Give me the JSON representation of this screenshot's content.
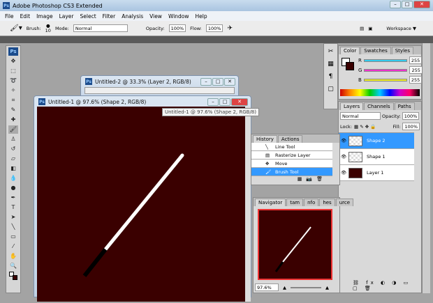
{
  "app": {
    "title": "Adobe Photoshop CS3 Extended",
    "logo": "Ps"
  },
  "menu": [
    "File",
    "Edit",
    "Image",
    "Layer",
    "Select",
    "Filter",
    "Analysis",
    "View",
    "Window",
    "Help"
  ],
  "options": {
    "brush_label": "Brush:",
    "brush_size": "10",
    "mode_label": "Mode:",
    "mode_value": "Normal",
    "opacity_label": "Opacity:",
    "opacity_value": "100%",
    "flow_label": "Flow:",
    "flow_value": "100%",
    "workspace_label": "Workspace ▼"
  },
  "documents": [
    {
      "title": "Untitled-2 @ 33.3% (Layer 2, RGB/8)"
    },
    {
      "title": "Untitled-1 @ 97.6% (Shape 2, RGB/8)",
      "tooltip": "Untitled-1 @ 97.6% (Shape 2, RGB/8)",
      "canvas_color": "#3a0000"
    }
  ],
  "color_panel": {
    "tabs": [
      "Color",
      "Swatches",
      "Styles"
    ],
    "channels": [
      {
        "label": "R",
        "value": "255",
        "color": "#33ccee"
      },
      {
        "label": "G",
        "value": "255",
        "color": "#ee33cc"
      },
      {
        "label": "B",
        "value": "255",
        "color": "#eeee22"
      }
    ],
    "foreground": "#ffffff",
    "background": "#3a0000"
  },
  "layers_panel": {
    "tabs": [
      "Layers",
      "Channels",
      "Paths"
    ],
    "blend_mode": "Normal",
    "opacity_label": "Opacity:",
    "opacity_value": "100%",
    "lock_label": "Lock:",
    "fill_label": "Fill:",
    "fill_value": "100%",
    "layers": [
      {
        "name": "Shape 2",
        "selected": true
      },
      {
        "name": "Shape 1",
        "selected": false
      },
      {
        "name": "Layer 1",
        "selected": false
      }
    ]
  },
  "history_panel": {
    "tabs": [
      "History",
      "Actions"
    ],
    "items": [
      {
        "name": "Line Tool",
        "icon": "line-icon"
      },
      {
        "name": "Rasterize Layer",
        "icon": "rasterize-icon"
      },
      {
        "name": "Move",
        "icon": "move-icon"
      },
      {
        "name": "Brush Tool",
        "icon": "brush-icon",
        "selected": true
      }
    ]
  },
  "navigator_panel": {
    "tabs": [
      "Navigator",
      "tam",
      "nfo",
      "hes",
      "urce"
    ],
    "zoom": "97.6%"
  }
}
